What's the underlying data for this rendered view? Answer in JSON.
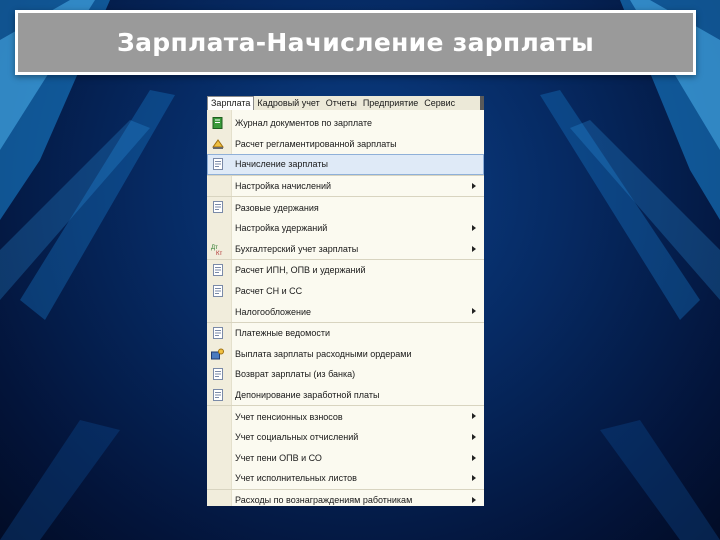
{
  "slide": {
    "title": "Зарплата-Начисление зарплаты"
  },
  "colors": {
    "background": "#062a63",
    "title_box": "#9a9a9a",
    "menu_highlight": "#dfeaf7"
  },
  "menubar": {
    "items": [
      "Зарплата",
      "Кадровый учет",
      "Отчеты",
      "Предприятие",
      "Сервис"
    ],
    "active_item": "Зарплата"
  },
  "menu": {
    "items": [
      {
        "label": "Журнал документов по зарплате",
        "icon": "journal-icon",
        "submenu": false
      },
      {
        "label": "Расчет регламентированной зарплаты",
        "icon": "calculator-icon",
        "submenu": false
      },
      {
        "label": "Начисление зарплаты",
        "icon": "document-icon",
        "submenu": false,
        "highlighted": true
      },
      {
        "label": "Настройка начислений",
        "icon": "",
        "submenu": true
      },
      {
        "label": "Разовые удержания",
        "icon": "document-icon",
        "submenu": false
      },
      {
        "label": "Настройка удержаний",
        "icon": "",
        "submenu": true
      },
      {
        "label": "Бухгалтерский учет зарплаты",
        "icon": "debit-credit-icon",
        "submenu": true
      },
      {
        "label": "Расчет ИПН, ОПВ и удержаний",
        "icon": "document-icon",
        "submenu": false
      },
      {
        "label": "Расчет СН и СС",
        "icon": "document-icon",
        "submenu": false
      },
      {
        "label": "Налогообложение",
        "icon": "",
        "submenu": true
      },
      {
        "label": "Платежные ведомости",
        "icon": "document-icon",
        "submenu": false
      },
      {
        "label": "Выплата зарплаты расходными ордерами",
        "icon": "payment-icon",
        "submenu": false
      },
      {
        "label": "Возврат зарплаты (из банка)",
        "icon": "document-icon",
        "submenu": false
      },
      {
        "label": "Депонирование заработной платы",
        "icon": "document-icon",
        "submenu": false
      },
      {
        "label": "Учет пенсионных взносов",
        "icon": "",
        "submenu": true
      },
      {
        "label": "Учет социальных отчислений",
        "icon": "",
        "submenu": true
      },
      {
        "label": "Учет пени ОПВ и СО",
        "icon": "",
        "submenu": true
      },
      {
        "label": "Учет исполнительных листов",
        "icon": "",
        "submenu": true
      },
      {
        "label": "Расходы по вознаграждениям работникам",
        "icon": "",
        "submenu": true
      }
    ]
  }
}
